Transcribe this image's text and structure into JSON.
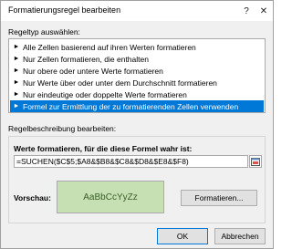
{
  "window": {
    "title": "Formatierungsregel bearbeiten",
    "help_label": "?",
    "close_label": "✕"
  },
  "rule_type": {
    "label": "Regeltyp auswählen:",
    "items": [
      {
        "label": "Alle Zellen basierend auf ihren Werten formatieren",
        "selected": false
      },
      {
        "label": "Nur Zellen formatieren, die enthalten",
        "selected": false
      },
      {
        "label": "Nur obere oder untere Werte formatieren",
        "selected": false
      },
      {
        "label": "Nur Werte über oder unter dem Durchschnitt formatieren",
        "selected": false
      },
      {
        "label": "Nur eindeutige oder doppelte Werte formatieren",
        "selected": false
      },
      {
        "label": "Formel zur Ermittlung der zu formatierenden Zellen verwenden",
        "selected": true
      }
    ],
    "bullet_icon": "arrow-right-icon"
  },
  "rule_description": {
    "label": "Regelbeschreibung bearbeiten:",
    "formula_heading": "Werte formatieren, für die diese Formel wahr ist:",
    "formula_value": "=SUCHEN($C$5;$A8&$B8&$C8&$D8&$E8&$F8)",
    "ref_icon": "collapse-dialog-icon",
    "preview_label": "Vorschau:",
    "preview_text": "AaBbCcYyZz",
    "format_button": "Formatieren..."
  },
  "footer": {
    "ok_label": "OK",
    "cancel_label": "Abbrechen"
  },
  "colors": {
    "selection": "#0078d7",
    "preview_fill": "#c6e0b4",
    "preview_text": "#3b5f2a"
  }
}
